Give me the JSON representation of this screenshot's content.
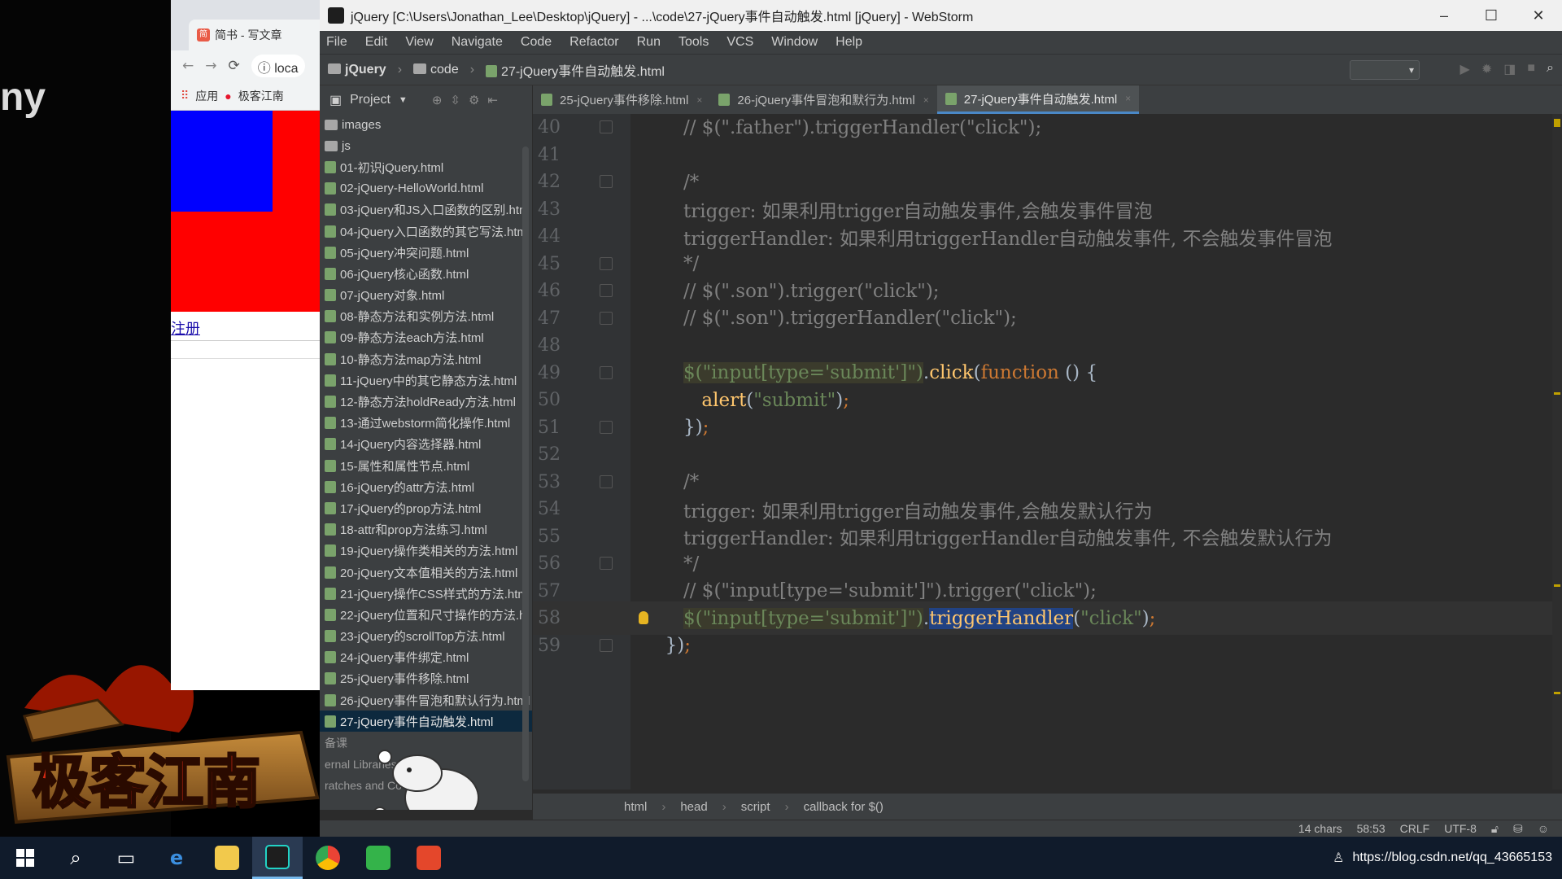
{
  "colors": {
    "editor_bg": "#2b2b2b",
    "panel_bg": "#3c3f41",
    "comment": "#808080",
    "string": "#6a8759",
    "function": "#ffc66d",
    "keyword": "#cc7832",
    "selection": "#214283"
  },
  "left_fragment": "ny",
  "browser": {
    "tab_title": "简书 - 写文章",
    "address": "loca",
    "bookmark_apps": "应用",
    "bookmark_2": "极客江南",
    "link_text": "注册"
  },
  "ide": {
    "window_title": "jQuery [C:\\Users\\Jonathan_Lee\\Desktop\\jQuery] - ...\\code\\27-jQuery事件自动触发.html [jQuery] - WebStorm",
    "window_controls": [
      "–",
      "☐",
      "✕"
    ],
    "menu": [
      "File",
      "Edit",
      "View",
      "Navigate",
      "Code",
      "Refactor",
      "Run",
      "Tools",
      "VCS",
      "Window",
      "Help"
    ],
    "nav_path": [
      "jQuery",
      "code",
      "27-jQuery事件自动触发.html"
    ],
    "project_label": "Project",
    "tabs": [
      {
        "label": "25-jQuery事件移除.html",
        "active": false
      },
      {
        "label": "26-jQuery事件冒泡和默行为.html",
        "active": false
      },
      {
        "label": "27-jQuery事件自动触发.html",
        "active": true
      }
    ],
    "tree": [
      {
        "label": "images",
        "type": "folder"
      },
      {
        "label": "js",
        "type": "folder"
      },
      {
        "label": "01-初识jQuery.html",
        "type": "file"
      },
      {
        "label": "02-jQuery-HelloWorld.html",
        "type": "file"
      },
      {
        "label": "03-jQuery和JS入口函数的区别.htm",
        "type": "file"
      },
      {
        "label": "04-jQuery入口函数的其它写法.htm",
        "type": "file"
      },
      {
        "label": "05-jQuery冲突问题.html",
        "type": "file"
      },
      {
        "label": "06-jQuery核心函数.html",
        "type": "file"
      },
      {
        "label": "07-jQuery对象.html",
        "type": "file"
      },
      {
        "label": "08-静态方法和实例方法.html",
        "type": "file"
      },
      {
        "label": "09-静态方法each方法.html",
        "type": "file"
      },
      {
        "label": "10-静态方法map方法.html",
        "type": "file"
      },
      {
        "label": "11-jQuery中的其它静态方法.html",
        "type": "file"
      },
      {
        "label": "12-静态方法holdReady方法.html",
        "type": "file"
      },
      {
        "label": "13-通过webstorm简化操作.html",
        "type": "file"
      },
      {
        "label": "14-jQuery内容选择器.html",
        "type": "file"
      },
      {
        "label": "15-属性和属性节点.html",
        "type": "file"
      },
      {
        "label": "16-jQuery的attr方法.html",
        "type": "file"
      },
      {
        "label": "17-jQuery的prop方法.html",
        "type": "file"
      },
      {
        "label": "18-attr和prop方法练习.html",
        "type": "file"
      },
      {
        "label": "19-jQuery操作类相关的方法.html",
        "type": "file"
      },
      {
        "label": "20-jQuery文本值相关的方法.html",
        "type": "file"
      },
      {
        "label": "21-jQuery操作CSS样式的方法.htm",
        "type": "file"
      },
      {
        "label": "22-jQuery位置和尺寸操作的方法.h",
        "type": "file"
      },
      {
        "label": "23-jQuery的scrollTop方法.html",
        "type": "file"
      },
      {
        "label": "24-jQuery事件绑定.html",
        "type": "file"
      },
      {
        "label": "25-jQuery事件移除.html",
        "type": "file"
      },
      {
        "label": "26-jQuery事件冒泡和默认行为.html",
        "type": "file"
      },
      {
        "label": "27-jQuery事件自动触发.html",
        "type": "file",
        "selected": true
      },
      {
        "label": "备课",
        "type": "dim"
      },
      {
        "label": "ernal Libraries",
        "type": "dim"
      },
      {
        "label": "ratches and Co",
        "type": "dim"
      }
    ],
    "code": [
      {
        "n": "40",
        "indent": 5,
        "parts": [
          {
            "c": "comment",
            "t": "// $(\".father\").triggerHandler(\"click\");"
          }
        ]
      },
      {
        "n": "41",
        "indent": 0,
        "parts": []
      },
      {
        "n": "42",
        "indent": 5,
        "parts": [
          {
            "c": "comment",
            "t": "/*"
          }
        ]
      },
      {
        "n": "43",
        "indent": 5,
        "parts": [
          {
            "c": "comment",
            "t": "trigger: 如果利用trigger自动触发事件,会触发事件冒泡"
          }
        ]
      },
      {
        "n": "44",
        "indent": 5,
        "parts": [
          {
            "c": "comment",
            "t": "triggerHandler: 如果利用triggerHandler自动触发事件, 不会触发事件冒泡"
          }
        ]
      },
      {
        "n": "45",
        "indent": 5,
        "parts": [
          {
            "c": "comment",
            "t": "*/"
          }
        ]
      },
      {
        "n": "46",
        "indent": 5,
        "parts": [
          {
            "c": "comment",
            "t": "// $(\".son\").trigger(\"click\");"
          }
        ]
      },
      {
        "n": "47",
        "indent": 5,
        "parts": [
          {
            "c": "comment",
            "t": "// $(\".son\").triggerHandler(\"click\");"
          }
        ]
      },
      {
        "n": "48",
        "indent": 0,
        "parts": []
      },
      {
        "n": "49",
        "indent": 5,
        "parts": [
          {
            "c": "str-hl",
            "t": "$(\"input[type='submit']\")"
          },
          {
            "c": "plain",
            "t": "."
          },
          {
            "c": "fn",
            "t": "click"
          },
          {
            "c": "plain",
            "t": "("
          },
          {
            "c": "kw",
            "t": "function"
          },
          {
            "c": "plain",
            "t": " () {"
          }
        ]
      },
      {
        "n": "50",
        "indent": 7,
        "parts": [
          {
            "c": "fn",
            "t": "alert"
          },
          {
            "c": "plain",
            "t": "("
          },
          {
            "c": "str",
            "t": "\"submit\""
          },
          {
            "c": "plain",
            "t": ")"
          },
          {
            "c": "kw",
            "t": ";"
          }
        ]
      },
      {
        "n": "51",
        "indent": 5,
        "parts": [
          {
            "c": "plain",
            "t": "})"
          },
          {
            "c": "kw",
            "t": ";"
          }
        ]
      },
      {
        "n": "52",
        "indent": 0,
        "parts": []
      },
      {
        "n": "53",
        "indent": 5,
        "parts": [
          {
            "c": "comment",
            "t": "/*"
          }
        ]
      },
      {
        "n": "54",
        "indent": 5,
        "parts": [
          {
            "c": "comment",
            "t": "trigger: 如果利用trigger自动触发事件,会触发默认行为"
          }
        ]
      },
      {
        "n": "55",
        "indent": 5,
        "parts": [
          {
            "c": "comment",
            "t": "triggerHandler: 如果利用triggerHandler自动触发事件, 不会触发默认行为"
          }
        ]
      },
      {
        "n": "56",
        "indent": 5,
        "parts": [
          {
            "c": "comment",
            "t": "*/"
          }
        ]
      },
      {
        "n": "57",
        "indent": 5,
        "parts": [
          {
            "c": "comment",
            "t": "// $(\"input[type='submit']\").trigger(\"click\");"
          }
        ]
      },
      {
        "n": "58",
        "indent": 5,
        "current": true,
        "parts": [
          {
            "c": "str-hl",
            "t": "$(\"input[type='submit']\")"
          },
          {
            "c": "plain",
            "t": "."
          },
          {
            "c": "sel",
            "t": "triggerHandler"
          },
          {
            "c": "plain",
            "t": "("
          },
          {
            "c": "str",
            "t": "\"click\""
          },
          {
            "c": "plain",
            "t": ")"
          },
          {
            "c": "kw",
            "t": ";"
          }
        ]
      },
      {
        "n": "59",
        "indent": 3,
        "parts": [
          {
            "c": "plain",
            "t": "})"
          },
          {
            "c": "kw",
            "t": ";"
          }
        ]
      }
    ],
    "breadcrumbs": [
      "html",
      "head",
      "script",
      "callback for $()"
    ],
    "status": {
      "chars": "14 chars",
      "position": "58:53",
      "line_sep": "CRLF",
      "encoding": "UTF-8"
    }
  },
  "taskbar": {
    "tray_url": "https://blog.csdn.net/qq_43665153"
  },
  "watermark": "极客江南"
}
